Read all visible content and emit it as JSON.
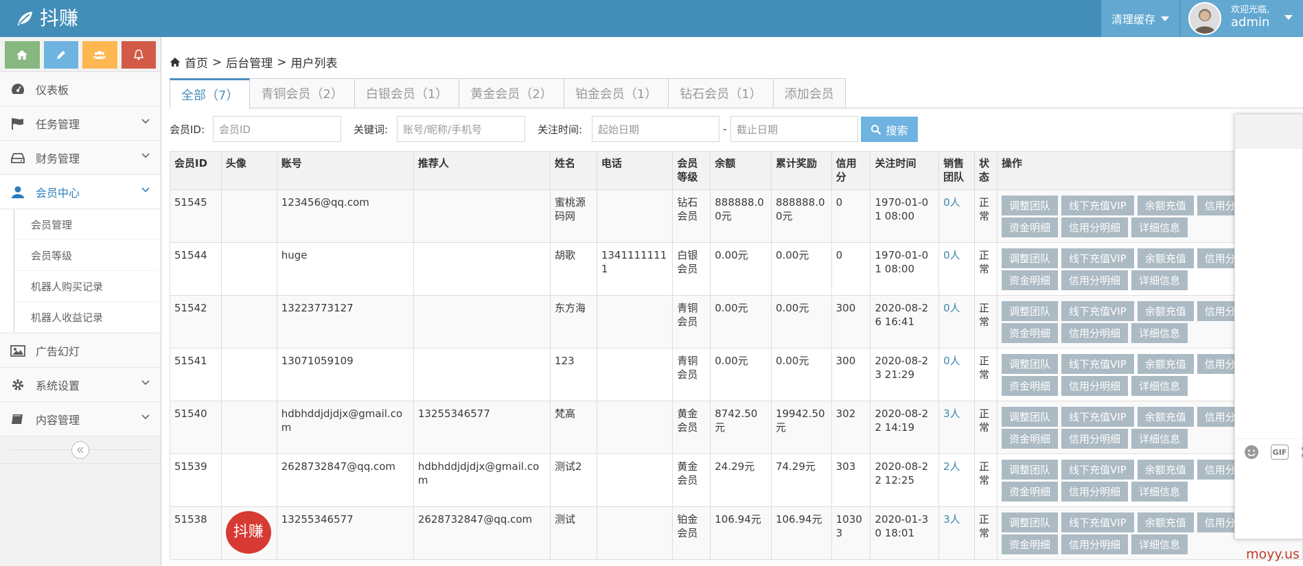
{
  "navbar": {
    "brand": "抖赚",
    "cache_label": "清理缓存",
    "welcome": "欢迎光临,",
    "username": "admin"
  },
  "sidebar": {
    "shortcuts": [
      {
        "icon": "home-icon",
        "color": "#87b87f"
      },
      {
        "icon": "pencil-icon",
        "color": "#6fb3e0"
      },
      {
        "icon": "users-icon",
        "color": "#ffb752"
      },
      {
        "icon": "bell-icon",
        "color": "#d15b47"
      }
    ],
    "items": [
      {
        "label": "仪表板",
        "icon": "dashboard-icon"
      },
      {
        "label": "任务管理",
        "icon": "flag-icon"
      },
      {
        "label": "财务管理",
        "icon": "hdd-icon"
      },
      {
        "label": "会员中心",
        "icon": "user-icon"
      },
      {
        "label": "广告幻灯",
        "icon": "picture-icon"
      },
      {
        "label": "系统设置",
        "icon": "cog-icon"
      },
      {
        "label": "内容管理",
        "icon": "book-icon"
      }
    ],
    "sub_items": [
      "会员管理",
      "会员等级",
      "机器人购买记录",
      "机器人收益记录"
    ]
  },
  "breadcrumb": {
    "home": "首页",
    "sep1": ">",
    "level2": "后台管理",
    "sep2": ">",
    "current": "用户列表"
  },
  "tabs": [
    "全部（7）",
    "青铜会员（2）",
    "白银会员（1）",
    "黄金会员（2）",
    "铂金会员（1）",
    "钻石会员（1）",
    "添加会员"
  ],
  "filter": {
    "member_id_label": "会员ID:",
    "member_id_placeholder": "会员ID",
    "keyword_label": "关键词:",
    "keyword_placeholder": "账号/昵称/手机号",
    "time_label": "关注时间:",
    "start_placeholder": "起始日期",
    "dash": "-",
    "end_placeholder": "截止日期",
    "search_label": "搜索"
  },
  "table": {
    "headers": [
      "会员ID",
      "头像",
      "账号",
      "推荐人",
      "姓名",
      "电话",
      "会员等级",
      "余额",
      "累计奖励",
      "信用分",
      "关注时间",
      "销售团队",
      "状态",
      "操作"
    ],
    "op_labels": [
      "调整团队",
      "线下充值VIP",
      "余额充值",
      "信用分充",
      "资金明细",
      "信用分明细",
      "详细信息"
    ],
    "rows": [
      {
        "id": "51545",
        "avatar": "",
        "account": "123456@qq.com",
        "referrer": "",
        "name": "蜜桃源码网",
        "phone": "",
        "level": "钻石会员",
        "balance": "888888.00元",
        "reward": "888888.00元",
        "credit": "0",
        "time": "1970-01-01 08:00",
        "team": "0人",
        "status": "正常"
      },
      {
        "id": "51544",
        "avatar": "",
        "account": "huge",
        "referrer": "",
        "name": "胡歌",
        "phone": "13411111111",
        "level": "白银会员",
        "balance": "0.00元",
        "reward": "0.00元",
        "credit": "0",
        "time": "1970-01-01 08:00",
        "team": "0人",
        "status": "正常"
      },
      {
        "id": "51542",
        "avatar": "",
        "account": "13223773127",
        "referrer": "",
        "name": "东方海",
        "phone": "",
        "level": "青铜会员",
        "balance": "0.00元",
        "reward": "0.00元",
        "credit": "300",
        "time": "2020-08-26 16:41",
        "team": "0人",
        "status": "正常"
      },
      {
        "id": "51541",
        "avatar": "",
        "account": "13071059109",
        "referrer": "",
        "name": "123",
        "phone": "",
        "level": "青铜会员",
        "balance": "0.00元",
        "reward": "0.00元",
        "credit": "300",
        "time": "2020-08-23 21:29",
        "team": "0人",
        "status": "正常"
      },
      {
        "id": "51540",
        "avatar": "",
        "account": "hdbhddjdjdjx@gmail.com",
        "referrer": "13255346577",
        "name": "梵高",
        "phone": "",
        "level": "黄金会员",
        "balance": "8742.50元",
        "reward": "19942.50元",
        "credit": "302",
        "time": "2020-08-22 14:19",
        "team": "3人",
        "status": "正常"
      },
      {
        "id": "51539",
        "avatar": "",
        "account": "2628732847@qq.com",
        "referrer": "hdbhddjdjdjx@gmail.com",
        "name": "测试2",
        "phone": "",
        "level": "黄金会员",
        "balance": "24.29元",
        "reward": "74.29元",
        "credit": "303",
        "time": "2020-08-22 12:25",
        "team": "2人",
        "status": "正常"
      },
      {
        "id": "51538",
        "avatar": "抖赚",
        "account": "13255346577",
        "referrer": "2628732847@qq.com",
        "name": "测试",
        "phone": "",
        "level": "铂金会员",
        "balance": "106.94元",
        "reward": "106.94元",
        "credit": "10303",
        "time": "2020-01-30 18:01",
        "team": "3人",
        "status": "正常"
      }
    ]
  },
  "chat": {
    "gif_label": "GIF"
  },
  "watermark": "moyy.us"
}
